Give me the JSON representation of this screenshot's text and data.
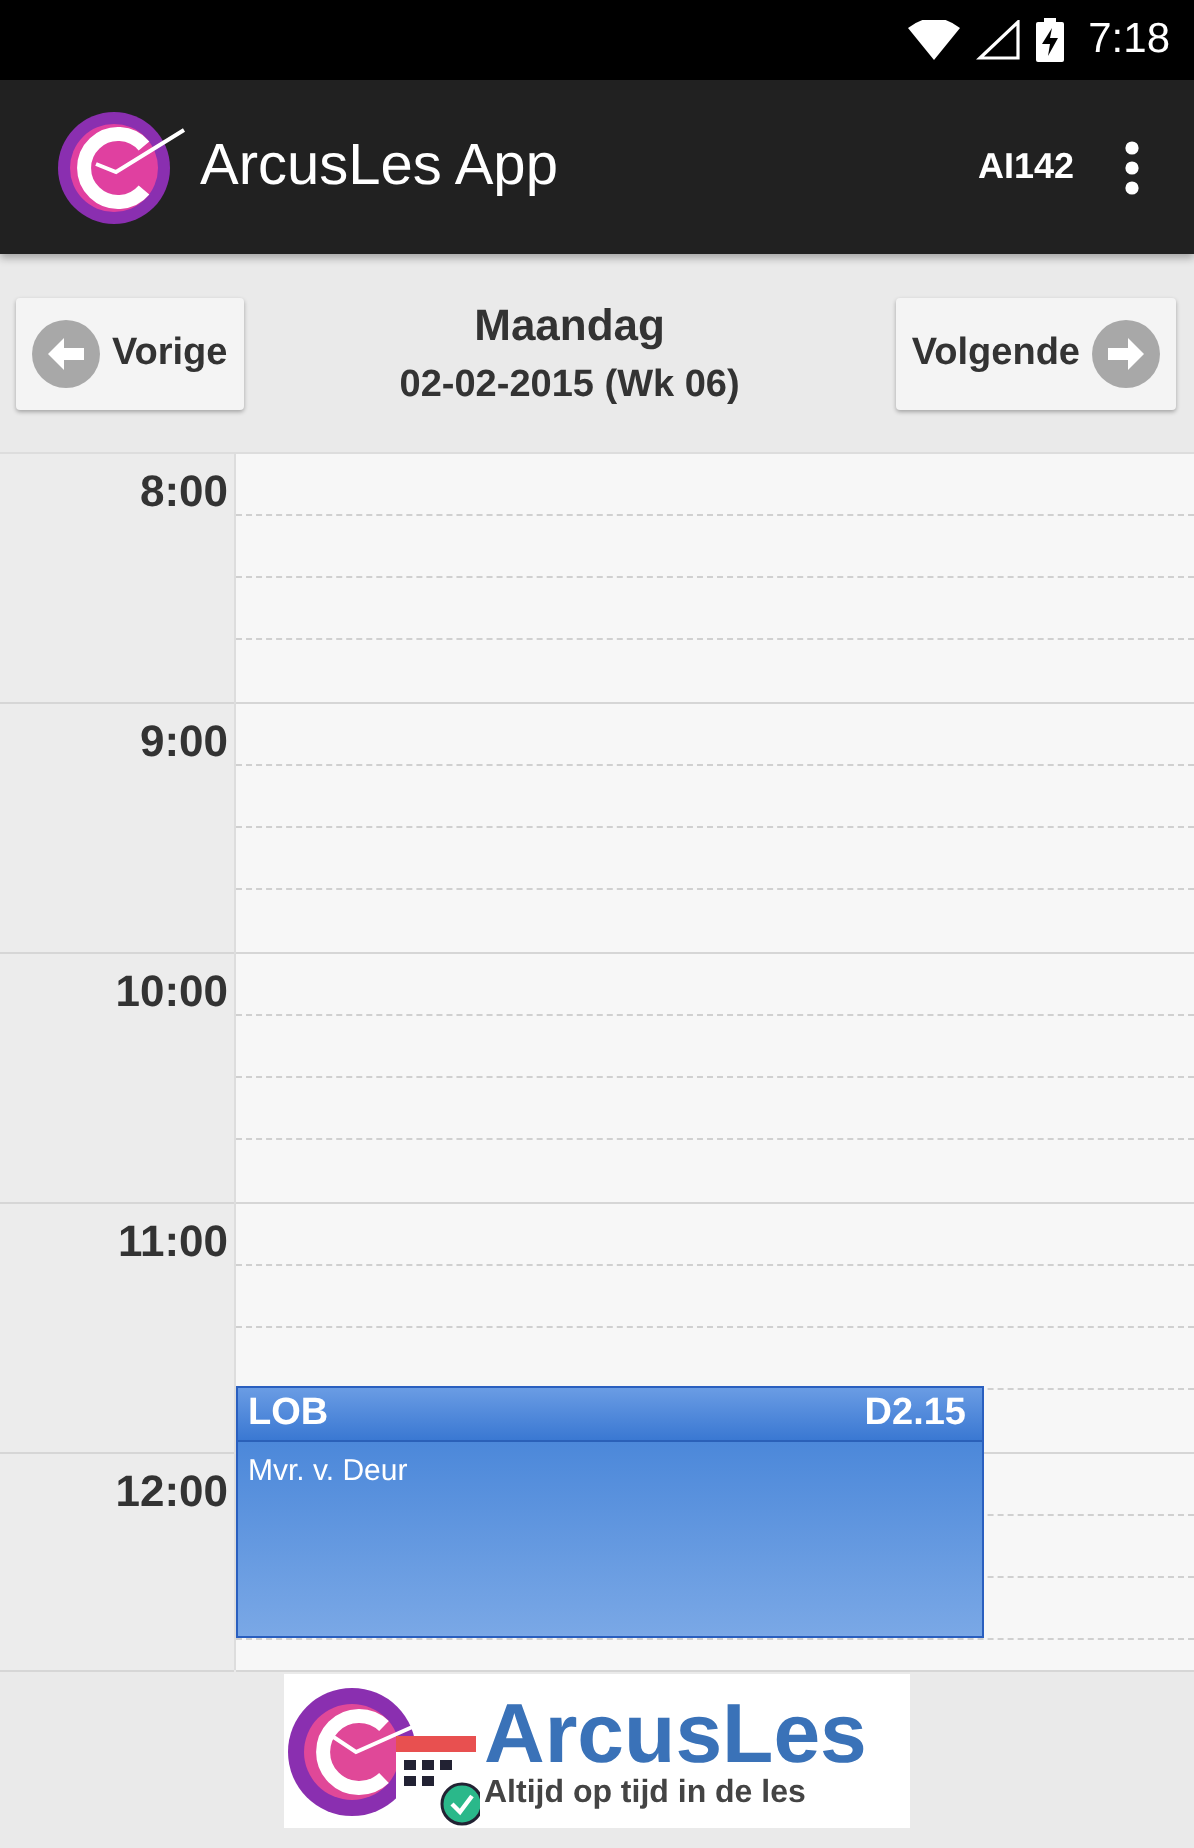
{
  "status_bar": {
    "time": "7:18"
  },
  "app_bar": {
    "title": "ArcusLes App",
    "user": "AI142"
  },
  "nav": {
    "previous": "Vorige",
    "day": "Maandag",
    "date": "02-02-2015 (Wk 06)",
    "next": "Volgende"
  },
  "hours": [
    "8:00",
    "9:00",
    "10:00",
    "11:00",
    "12:00"
  ],
  "events": [
    {
      "title": "LOB",
      "room": "D2.15",
      "teacher": "Mvr. v. Deur"
    }
  ],
  "banner": {
    "title": "ArcusLes",
    "tagline": "Altijd op tijd in de les"
  }
}
